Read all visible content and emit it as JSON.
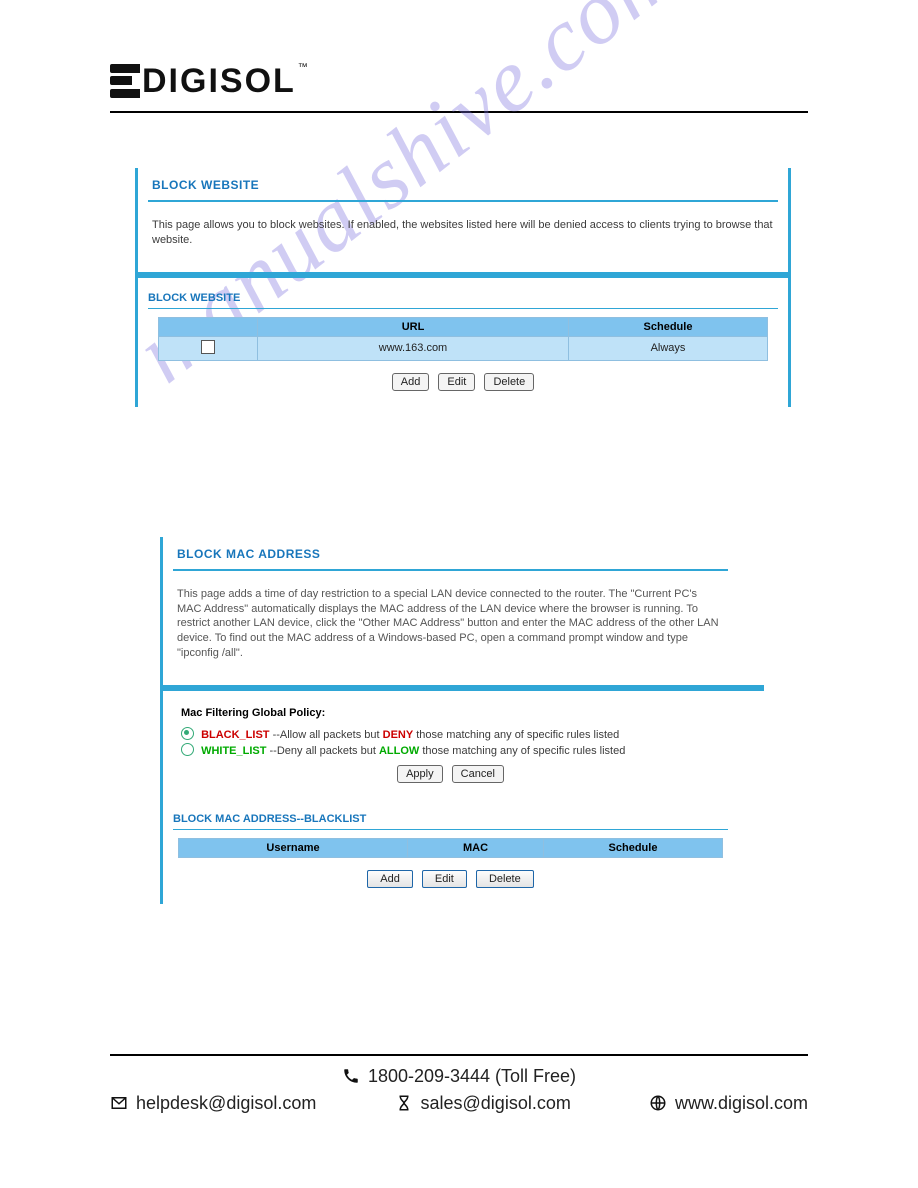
{
  "brand": "DIGISOL",
  "watermark": "manualshive.com",
  "block_website": {
    "header": "BLOCK WEBSITE",
    "description": "This page allows you to block websites. If enabled, the websites listed here will be denied access to clients trying to browse that website.",
    "section_title": "BLOCK WEBSITE",
    "columns": {
      "url": "URL",
      "schedule": "Schedule"
    },
    "rows": [
      {
        "url": "www.163.com",
        "schedule": "Always"
      }
    ],
    "buttons": {
      "add": "Add",
      "edit": "Edit",
      "delete": "Delete"
    }
  },
  "block_mac": {
    "header": "BLOCK MAC ADDRESS",
    "description": "This page adds a time of day restriction to a special LAN device connected to the router. The \"Current PC's MAC Address\" automatically displays the MAC address of the LAN device where the browser is running. To restrict another LAN device, click the \"Other MAC Address\" button and enter the MAC address of the other LAN device. To find out the MAC address of a Windows-based PC, open a command prompt window and type \"ipconfig /all\".",
    "policy_title": "Mac Filtering Global Policy:",
    "black": {
      "name": "BLACK_LIST",
      "pre": " --Allow all packets but ",
      "deny": "DENY",
      "post": " those matching any of specific rules listed"
    },
    "white": {
      "name": "WHITE_LIST",
      "pre": " --Deny all packets but ",
      "allow": "ALLOW",
      "post": " those matching any of specific rules listed"
    },
    "apply": "Apply",
    "cancel": "Cancel",
    "section_title": "BLOCK MAC ADDRESS--BLACKLIST",
    "columns": {
      "username": "Username",
      "mac": "MAC",
      "schedule": "Schedule"
    },
    "buttons": {
      "add": "Add",
      "edit": "Edit",
      "delete": "Delete"
    }
  },
  "footer": {
    "phone": "1800-209-3444 (Toll Free)",
    "helpdesk": "helpdesk@digisol.com",
    "sales": "sales@digisol.com",
    "web": "www.digisol.com"
  }
}
